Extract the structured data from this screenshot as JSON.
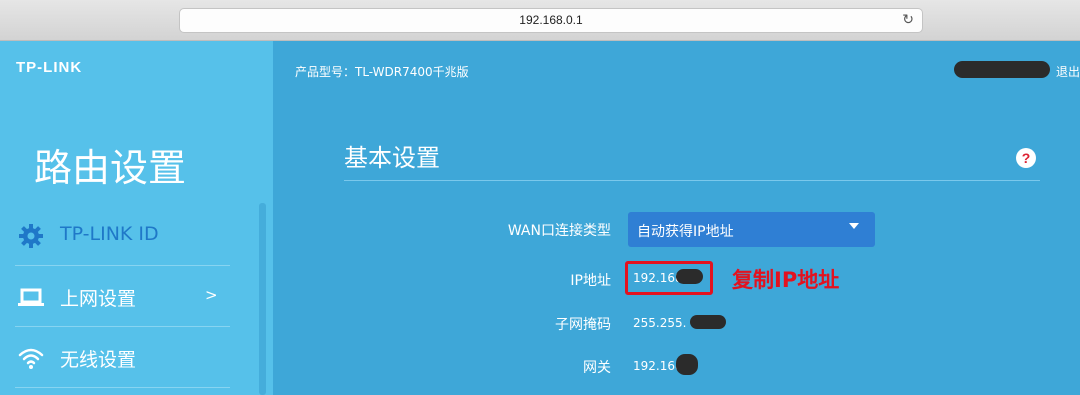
{
  "browser": {
    "url": "192.168.0.1"
  },
  "brand": {
    "logo_text": "TP-LINK"
  },
  "sidebar": {
    "title": "路由设置",
    "items": [
      {
        "label": "TP-LINK ID",
        "icon": "gear-icon",
        "color": "#1f78c8"
      },
      {
        "label": "上网设置",
        "icon": "laptop-icon",
        "arrow": ">",
        "color": "#ffffff"
      },
      {
        "label": "无线设置",
        "icon": "wifi-icon",
        "color": "#ffffff"
      }
    ]
  },
  "header": {
    "model": "产品型号：TL-WDR7400千兆版",
    "logout": "退出"
  },
  "panel": {
    "title": "基本设置",
    "help": "?",
    "wan_type": {
      "label": "WAN口连接类型",
      "value": "自动获得IP地址"
    },
    "ip": {
      "label": "IP地址",
      "value": "192.168"
    },
    "mask": {
      "label": "子网掩码",
      "value": "255.255."
    },
    "gateway": {
      "label": "网关",
      "value": "192.168"
    }
  },
  "annotation": {
    "text": "复制IP地址",
    "color": "#e3121f"
  },
  "colors": {
    "sidebar_bg": "#56c1ea",
    "main_bg": "#3ea7d8",
    "select_bg": "#2f7fd4"
  }
}
